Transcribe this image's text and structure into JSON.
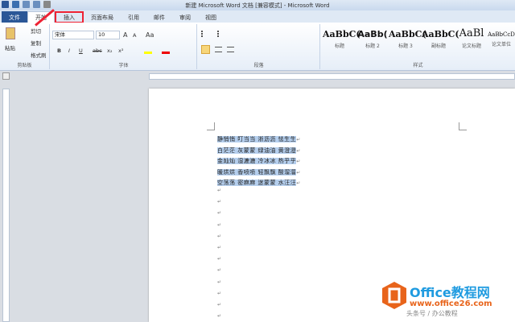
{
  "window": {
    "title": "新建 Microsoft Word 文档 [兼容模式] - Microsoft Word"
  },
  "tabs": [
    {
      "label": "文件"
    },
    {
      "label": "开始"
    },
    {
      "label": "插入"
    },
    {
      "label": "页面布局"
    },
    {
      "label": "引用"
    },
    {
      "label": "邮件"
    },
    {
      "label": "审阅"
    },
    {
      "label": "视图"
    }
  ],
  "clipboard": {
    "paste": "粘贴",
    "cut": "剪切",
    "copy": "复制",
    "format_painter": "格式刷",
    "label": "剪贴板"
  },
  "font": {
    "name": "宋体",
    "size": "10",
    "label": "字体",
    "grow": "A",
    "shrink": "A",
    "case": "Aa",
    "bold": "B",
    "italic": "I",
    "underline": "U",
    "strike": "abc",
    "sub": "x₂",
    "sup": "x²"
  },
  "paragraph": {
    "label": "段落"
  },
  "styles": {
    "label": "样式",
    "items": [
      {
        "sample": "AaBbC(",
        "name": "标题"
      },
      {
        "sample": "AaBb(",
        "name": "标题 2"
      },
      {
        "sample": "AaBbC(",
        "name": "标题 3"
      },
      {
        "sample": "AaBbC(",
        "name": "副标题"
      },
      {
        "sample": "AaBl",
        "name": "论文标题"
      },
      {
        "sample": "AaBbCcD",
        "name": "论文单位"
      }
    ]
  },
  "document": {
    "lines": [
      "静悄悄 叮当当 淅沥沥 怯生生",
      "白茫茫 灰蒙蒙 绿油油 黄澄澄",
      "金灿灿 湿漉漉 冷冰冰 热乎乎",
      "暖烘烘 香喷喷 轻飘飘 酸溜溜",
      "空荡荡 密麻麻 迷蒙蒙 水汪汪"
    ],
    "paragraph_mark": "↵"
  },
  "watermark": {
    "brand": "Office教程网",
    "url": "www.office26.com",
    "credit": "头条号 / 办公教程"
  },
  "colors": {
    "file_tab": "#2b5797",
    "highlight": "#e22233",
    "selection": "#b5cfee",
    "logo": "#e8641b"
  }
}
